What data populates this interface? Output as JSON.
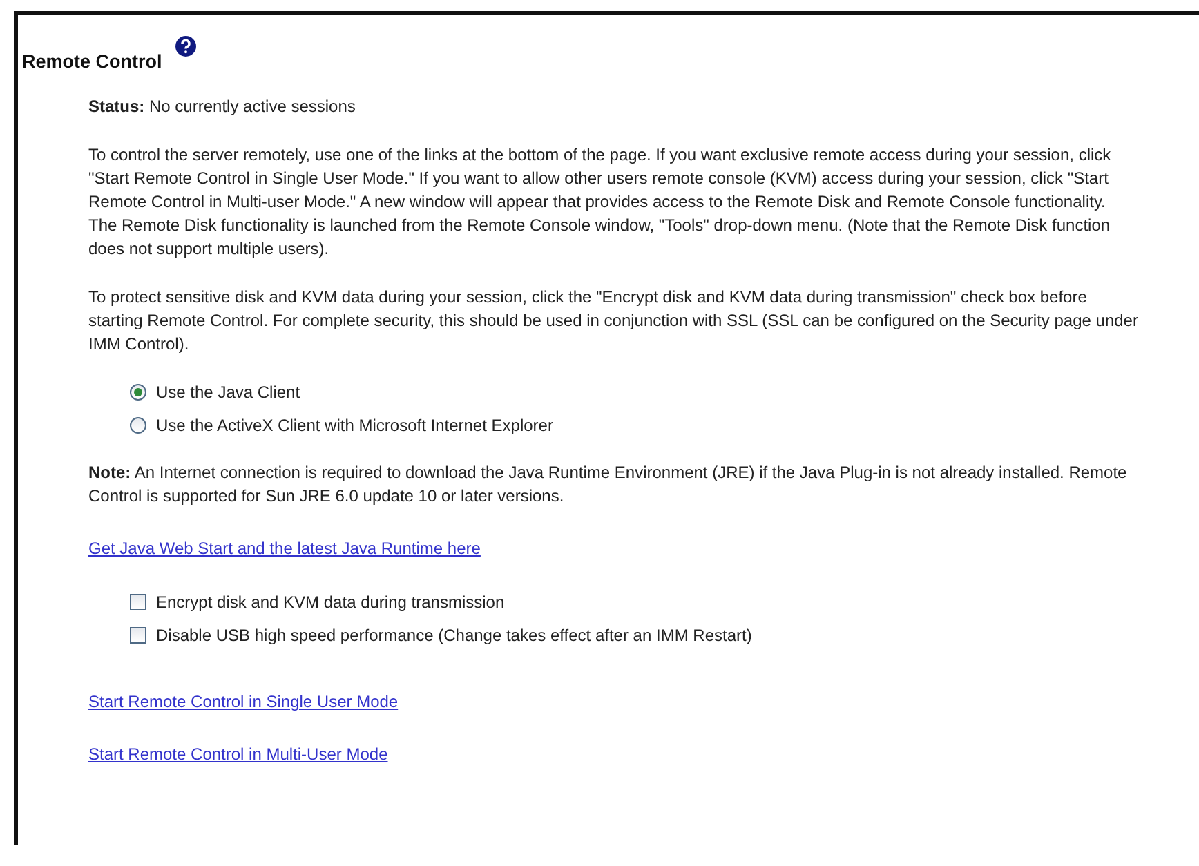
{
  "title": "Remote Control",
  "status": {
    "label": "Status:",
    "value": "No currently active sessions"
  },
  "paragraphs": [
    "To control the server remotely, use one of the links at the bottom of the page. If you want exclusive remote access during your session, click \"Start Remote Control in Single User Mode.\" If you want to allow other users remote console (KVM) access during your session, click \"Start Remote Control in Multi-user Mode.\" A new window will appear that provides access to the Remote Disk and Remote Console functionality. The Remote Disk functionality is launched from the Remote Console window, \"Tools\" drop-down menu. (Note that the Remote Disk function does not support multiple users).",
    "To protect sensitive disk and KVM data during your session, click the \"Encrypt disk and KVM data during transmission\" check box before starting Remote Control. For complete security, this should be used in conjunction with SSL (SSL can be configured on the Security page under IMM Control)."
  ],
  "client_options": [
    {
      "label": "Use the Java Client",
      "selected": true
    },
    {
      "label": "Use the ActiveX Client with Microsoft Internet Explorer",
      "selected": false
    }
  ],
  "note": "**Note:** An Internet connection is required to download the Java Runtime Environment (JRE) if the Java Plug-in is not already installed. Remote Control is supported for Sun JRE 6.0 update 10 or later versions.",
  "java_link": "Get Java Web Start and the latest Java Runtime here",
  "checkboxes": [
    {
      "label": "Encrypt disk and KVM data during transmission",
      "checked": false
    },
    {
      "label": "Disable USB high speed performance (Change takes effect after an IMM Restart)",
      "checked": false
    }
  ],
  "start_links": [
    "Start Remote Control in Single User Mode",
    "Start Remote Control in Multi-User Mode"
  ]
}
